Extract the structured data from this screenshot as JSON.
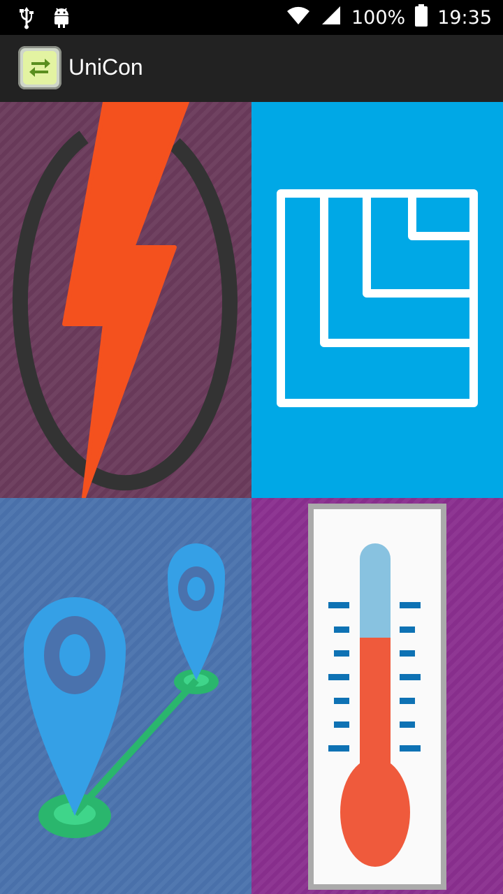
{
  "status_bar": {
    "battery": "100%",
    "time": "19:35"
  },
  "app_bar": {
    "title": "UniCon"
  },
  "tiles": [
    {
      "name": "power",
      "icon": "power-icon",
      "colors": {
        "bg": "#6a3a5b",
        "accent": "#f4511e"
      }
    },
    {
      "name": "area",
      "icon": "area-icon",
      "colors": {
        "bg": "#00a8e6",
        "accent": "#ffffff"
      }
    },
    {
      "name": "distance",
      "icon": "distance-icon",
      "colors": {
        "bg": "#4a72ad",
        "accent": "#35b0e6"
      }
    },
    {
      "name": "temperature",
      "icon": "thermometer-icon",
      "colors": {
        "bg": "#8a2f8f",
        "accent": "#ef5a3c"
      }
    }
  ]
}
